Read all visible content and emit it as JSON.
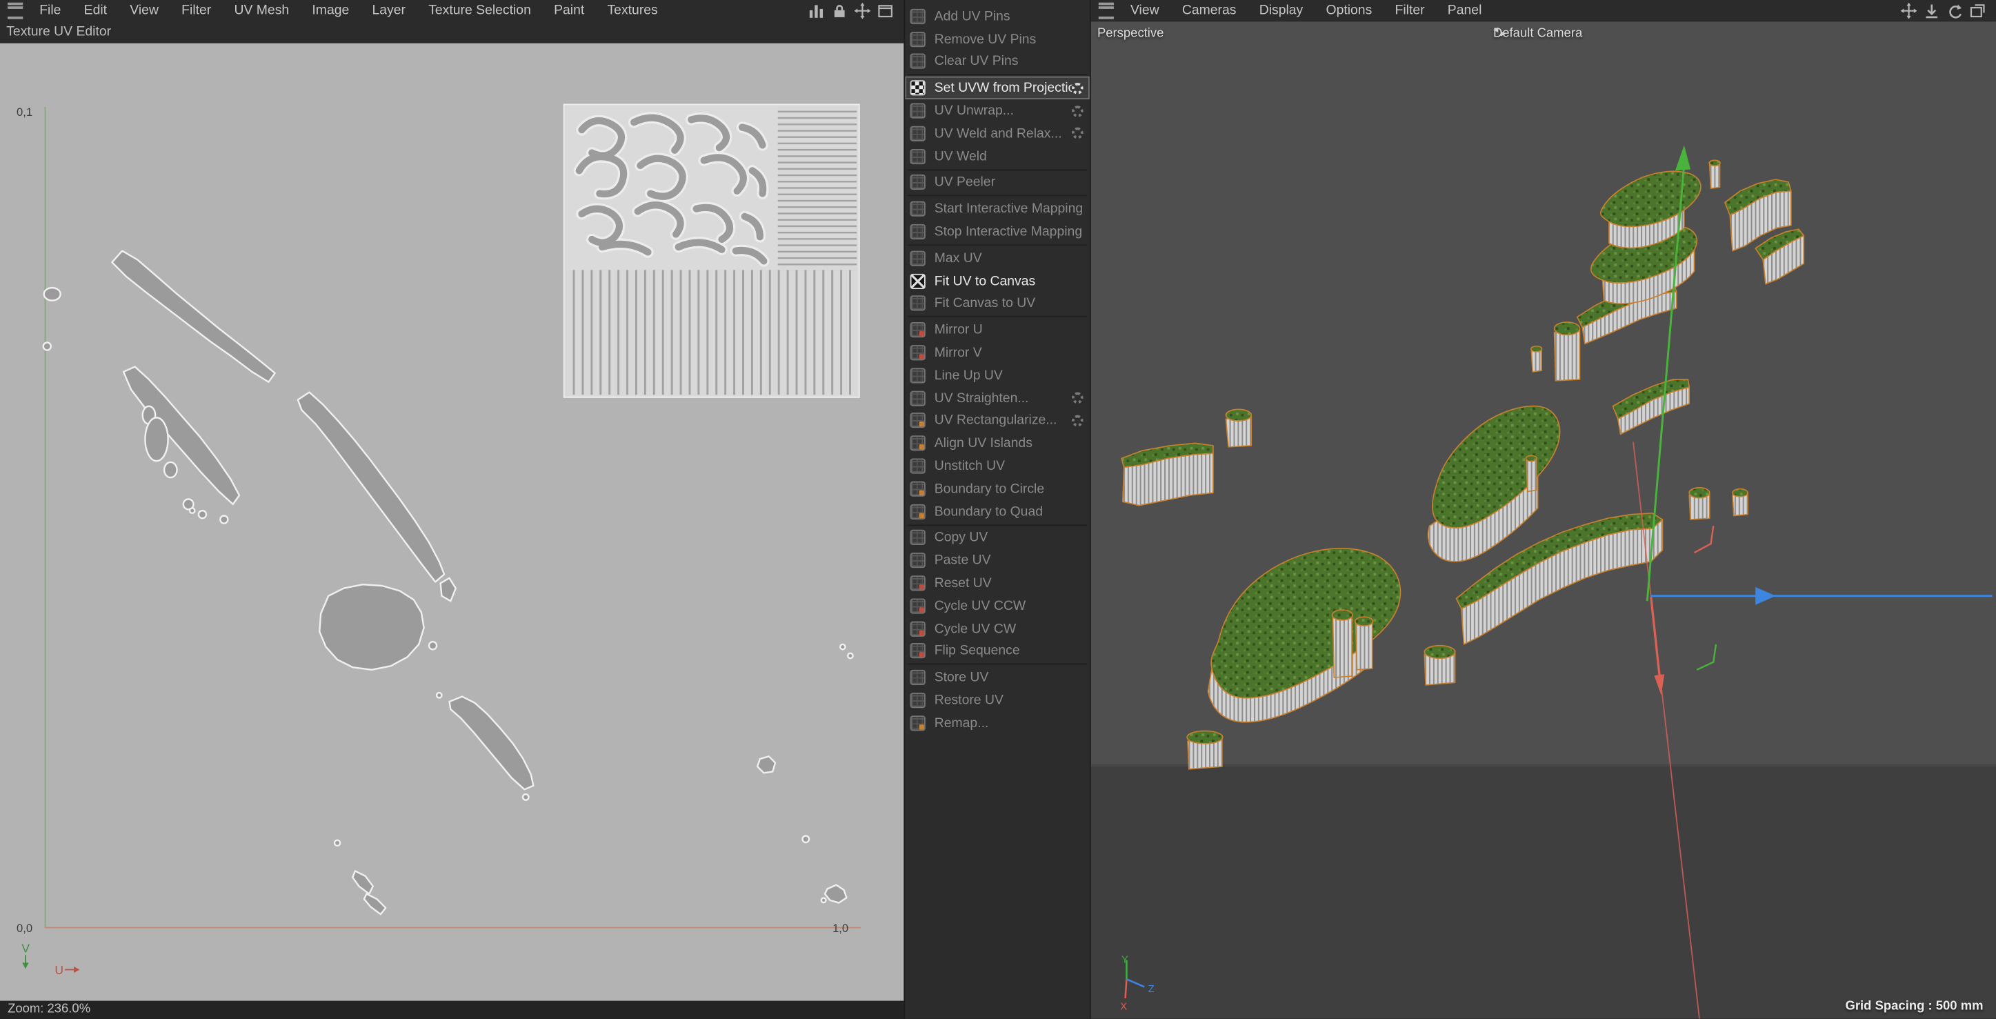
{
  "left_panel": {
    "title": "Texture UV Editor",
    "menu": [
      "File",
      "Edit",
      "View",
      "Filter",
      "UV Mesh",
      "Image",
      "Layer",
      "Texture Selection",
      "Paint",
      "Textures"
    ],
    "header_icons": [
      "histogram-icon",
      "lock-icon",
      "pan-icon",
      "dock-icon"
    ],
    "status": {
      "zoom_label": "Zoom: 236.0%"
    },
    "uv_axes": {
      "top_left": "0,1",
      "origin": "0,0",
      "bottom_right": "1,0",
      "v": "V",
      "u": "U"
    }
  },
  "commands_panel": {
    "items": [
      {
        "label": "Add UV Pins",
        "icon": "pin-add-icon",
        "enabled": false,
        "gear": false,
        "accent": null,
        "sep": false
      },
      {
        "label": "Remove UV Pins",
        "icon": "pin-remove-icon",
        "enabled": false,
        "gear": false,
        "accent": null,
        "sep": false
      },
      {
        "label": "Clear UV Pins",
        "icon": "pin-clear-icon",
        "enabled": false,
        "gear": false,
        "accent": null,
        "sep": true
      },
      {
        "label": "Set UVW from Projection...",
        "icon": "checkerboard-icon",
        "enabled": true,
        "highlight": true,
        "gear": true,
        "accent": null,
        "sep": false
      },
      {
        "label": "UV Unwrap...",
        "icon": "unwrap-icon",
        "enabled": false,
        "gear": true,
        "accent": null,
        "sep": false
      },
      {
        "label": "UV Weld and Relax...",
        "icon": "weld-relax-icon",
        "enabled": false,
        "gear": true,
        "accent": null,
        "sep": false
      },
      {
        "label": "UV Weld",
        "icon": "weld-icon",
        "enabled": false,
        "gear": false,
        "accent": null,
        "sep": true
      },
      {
        "label": "UV Peeler",
        "icon": "peeler-icon",
        "enabled": false,
        "gear": false,
        "accent": null,
        "sep": true
      },
      {
        "label": "Start Interactive Mapping",
        "icon": "interactive-mapping-start-icon",
        "enabled": false,
        "gear": false,
        "accent": null,
        "sep": false
      },
      {
        "label": "Stop Interactive Mapping",
        "icon": "interactive-mapping-stop-icon",
        "enabled": false,
        "gear": false,
        "accent": null,
        "sep": true
      },
      {
        "label": "Max UV",
        "icon": "max-uv-icon",
        "enabled": false,
        "gear": false,
        "accent": null,
        "sep": false
      },
      {
        "label": "Fit UV to Canvas",
        "icon": "fit-uv-canvas-icon",
        "enabled": true,
        "gear": false,
        "accent": null,
        "sep": false
      },
      {
        "label": "Fit Canvas to UV",
        "icon": "fit-canvas-uv-icon",
        "enabled": false,
        "gear": false,
        "accent": null,
        "sep": true
      },
      {
        "label": "Mirror U",
        "icon": "mirror-u-icon",
        "enabled": false,
        "gear": false,
        "accent": "red",
        "sep": false
      },
      {
        "label": "Mirror V",
        "icon": "mirror-v-icon",
        "enabled": false,
        "gear": false,
        "accent": "red",
        "sep": false
      },
      {
        "label": "Line Up UV",
        "icon": "line-up-icon",
        "enabled": false,
        "gear": false,
        "accent": null,
        "sep": false
      },
      {
        "label": "UV Straighten...",
        "icon": "straighten-icon",
        "enabled": false,
        "gear": true,
        "accent": null,
        "sep": false
      },
      {
        "label": "UV Rectangularize...",
        "icon": "rectangularize-icon",
        "enabled": false,
        "gear": true,
        "accent": "orange",
        "sep": false
      },
      {
        "label": "Align UV Islands",
        "icon": "align-islands-icon",
        "enabled": false,
        "gear": false,
        "accent": "orange",
        "sep": false
      },
      {
        "label": "Unstitch UV",
        "icon": "unstitch-icon",
        "enabled": false,
        "gear": false,
        "accent": null,
        "sep": false
      },
      {
        "label": "Boundary to Circle",
        "icon": "boundary-circle-icon",
        "enabled": false,
        "gear": false,
        "accent": "orange",
        "sep": false
      },
      {
        "label": "Boundary to Quad",
        "icon": "boundary-quad-icon",
        "enabled": false,
        "gear": false,
        "accent": "orange",
        "sep": true
      },
      {
        "label": "Copy UV",
        "icon": "copy-icon",
        "enabled": false,
        "gear": false,
        "accent": null,
        "sep": false
      },
      {
        "label": "Paste UV",
        "icon": "paste-icon",
        "enabled": false,
        "gear": false,
        "accent": null,
        "sep": false
      },
      {
        "label": "Reset UV",
        "icon": "reset-icon",
        "enabled": false,
        "gear": false,
        "accent": "red",
        "sep": false
      },
      {
        "label": "Cycle UV CCW",
        "icon": "cycle-ccw-icon",
        "enabled": false,
        "gear": false,
        "accent": "red",
        "sep": false
      },
      {
        "label": "Cycle UV CW",
        "icon": "cycle-cw-icon",
        "enabled": false,
        "gear": false,
        "accent": "red",
        "sep": false
      },
      {
        "label": "Flip Sequence",
        "icon": "flip-icon",
        "enabled": false,
        "gear": false,
        "accent": "red",
        "sep": true
      },
      {
        "label": "Store UV",
        "icon": "store-icon",
        "enabled": false,
        "gear": false,
        "accent": null,
        "sep": false
      },
      {
        "label": "Restore UV",
        "icon": "restore-icon",
        "enabled": false,
        "gear": false,
        "accent": null,
        "sep": false
      },
      {
        "label": "Remap...",
        "icon": "remap-icon",
        "enabled": false,
        "gear": false,
        "accent": "orange",
        "sep": false
      }
    ]
  },
  "viewport": {
    "menu": [
      "View",
      "Cameras",
      "Display",
      "Options",
      "Filter",
      "Panel"
    ],
    "header_icons": [
      "pan-icon",
      "download-icon",
      "sync-icon",
      "float-icon"
    ],
    "view_label": "Perspective",
    "camera_label": "Default Camera",
    "grid_spacing_label": "Grid Spacing : 500 mm",
    "axis_gizmo": {
      "x": "X",
      "y": "Y",
      "z": "Z"
    }
  },
  "colors": {
    "canvas_bg": "#b3b3b3",
    "panel_bg": "#2c2c2c",
    "menubar_bg": "#2b2b2b",
    "island_fill": "#9b9b9b",
    "island_stroke": "#f0f0f0",
    "uv_axis_u_red": "#c18a74",
    "uv_axis_v_green": "#84a87a",
    "viewport_bg": "#4f4f4f",
    "viewport_ground": "#3f3f3f",
    "axis_x_red": "#d96156",
    "axis_y_green": "#49b33c",
    "axis_z_blue": "#3d86e0",
    "terrain_green": "#4c752c",
    "selection_orange": "#c8802e",
    "enabled_text": "#e9e9e9",
    "disabled_text": "#8a8a8a"
  }
}
